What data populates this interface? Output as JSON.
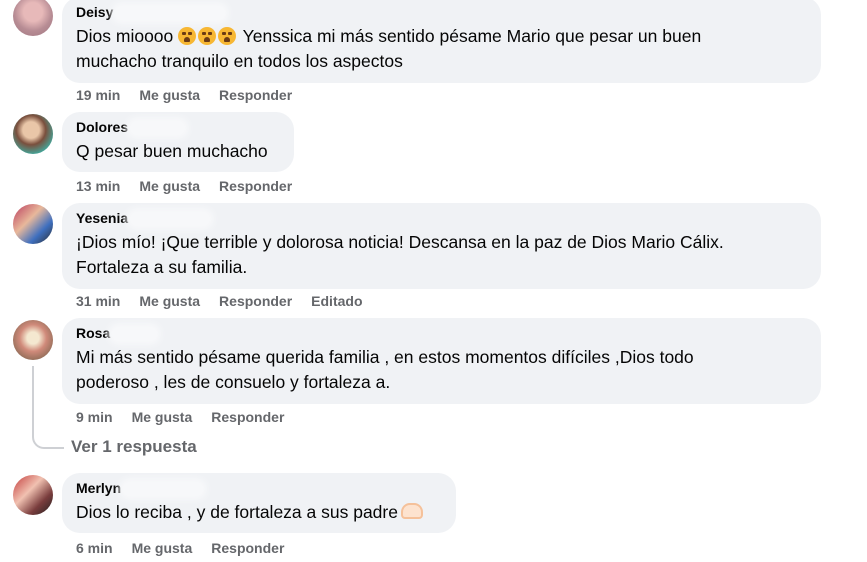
{
  "comments": [
    {
      "author": "Deisy",
      "text_before_emoji": "Dios mioooo ",
      "text_after_emoji": " Yenssica mi más sentido pésame Mario que pesar un buen\nmuchacho tranquilo en todos los aspectos",
      "emoji_icon": "crying-face-emoji x3",
      "time": "19 min",
      "like": "Me gusta",
      "reply": "Responder"
    },
    {
      "author": "Dolores",
      "text": "Q pesar buen muchacho",
      "time": "13 min",
      "like": "Me gusta",
      "reply": "Responder"
    },
    {
      "author": "Yesenia",
      "text": "¡Dios mío! ¡Que terrible y dolorosa noticia! Descansa en la paz de Dios Mario Cálix.\nFortaleza a su familia.",
      "time": "31 min",
      "like": "Me gusta",
      "reply": "Responder",
      "edited": "Editado"
    },
    {
      "author": "Rosa",
      "text": "Mi más sentido pésame querida familia , en estos momentos difíciles ,Dios todo\npoderoso , les de consuelo y fortaleza a.",
      "time": "9 min",
      "like": "Me gusta",
      "reply": "Responder",
      "replies_link": "Ver 1 respuesta"
    },
    {
      "author": "Merlyn",
      "text": "Dios lo reciba , y de fortaleza a sus padre",
      "emoji_icon": "heart-hands-emoji",
      "time": "6 min",
      "like": "Me gusta",
      "reply": "Responder"
    }
  ],
  "colors": {
    "bubble": "#f0f2f5",
    "meta_text": "#65676b",
    "body_text": "#050505"
  }
}
